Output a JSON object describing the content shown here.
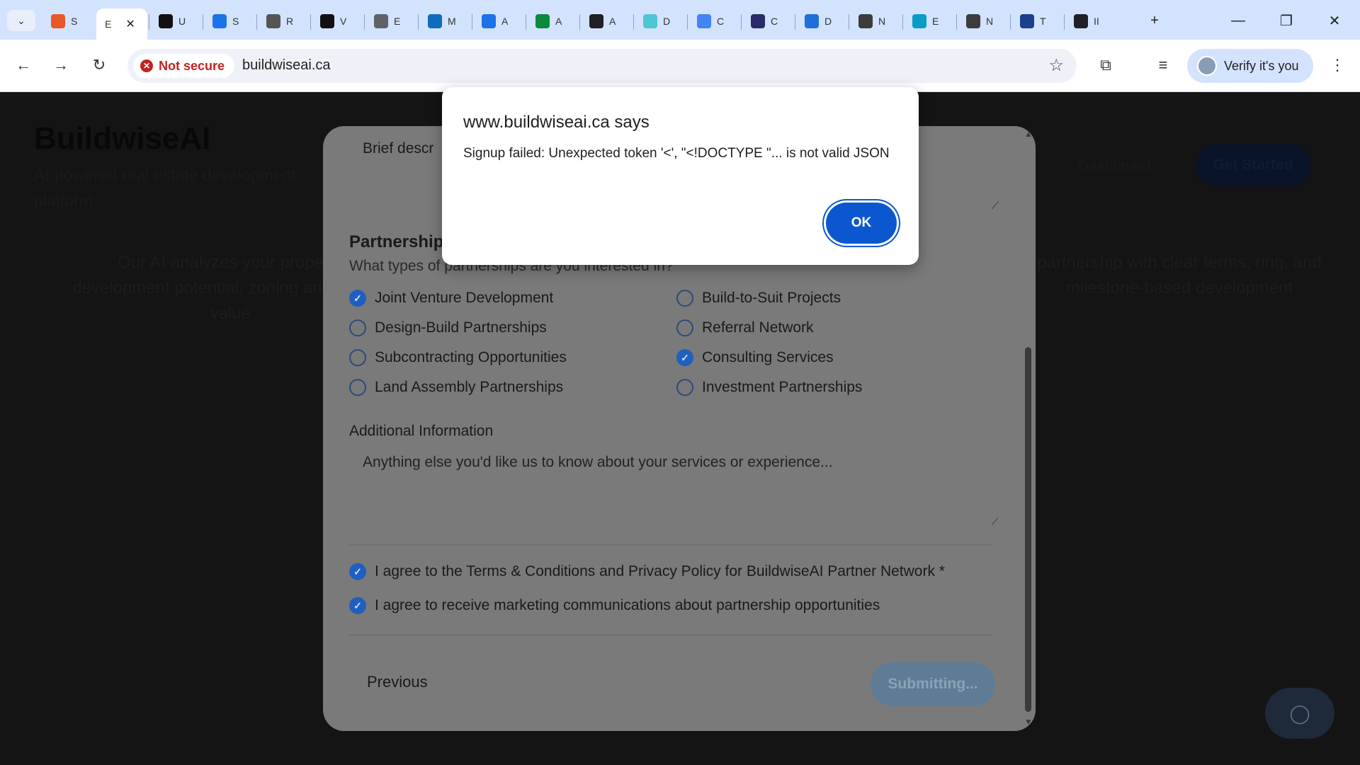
{
  "browser": {
    "tabs": [
      {
        "label": "S",
        "color": "#e8572a"
      },
      {
        "label": "E",
        "color": "#ffffff"
      },
      {
        "label": "U",
        "color": "#111111"
      },
      {
        "label": "S",
        "color": "#1a73e8"
      },
      {
        "label": "R",
        "color": "#555555"
      },
      {
        "label": "V",
        "color": "#111111"
      },
      {
        "label": "E",
        "color": "#5f6368"
      },
      {
        "label": "M",
        "color": "#0f6cbd"
      },
      {
        "label": "A",
        "color": "#1a73e8"
      },
      {
        "label": "A",
        "color": "#0a8a3a"
      },
      {
        "label": "A",
        "color": "#202124"
      },
      {
        "label": "D",
        "color": "#4ec6d4"
      },
      {
        "label": "C",
        "color": "#4285f4"
      },
      {
        "label": "C",
        "color": "#2b2b6b"
      },
      {
        "label": "D",
        "color": "#1e6fd9"
      },
      {
        "label": "N",
        "color": "#3c3c3c"
      },
      {
        "label": "E",
        "color": "#0a9cc7"
      },
      {
        "label": "N",
        "color": "#3c3c3c"
      },
      {
        "label": "T",
        "color": "#1b3f8b"
      },
      {
        "label": "II",
        "color": "#202124"
      }
    ],
    "new_tab": "+",
    "window_controls": {
      "minimize": "—",
      "restore": "❐",
      "close": "✕"
    },
    "security_label": "Not secure",
    "url": "buildwiseai.ca",
    "profile_label": "Verify it's you"
  },
  "page": {
    "brand": "BuildwiseAI",
    "tagline": "AI-powered real estate development platform",
    "nav_dashboard": "Dashboard",
    "nav_get_started": "Get Started",
    "feature_left": "Our AI analyzes your property development potential, zoning and market value",
    "feature_right": "partnership with clear terms, ring, and milestone-based development"
  },
  "modal": {
    "brief_placeholder": "Brief descr",
    "partnership_heading": "Partnership",
    "partnership_question": "What types of partnerships are you interested in?",
    "options": [
      {
        "label": "Joint Venture Development",
        "checked": true
      },
      {
        "label": "Build-to-Suit Projects",
        "checked": false
      },
      {
        "label": "Design-Build Partnerships",
        "checked": false
      },
      {
        "label": "Referral Network",
        "checked": false
      },
      {
        "label": "Subcontracting Opportunities",
        "checked": false
      },
      {
        "label": "Consulting Services",
        "checked": true
      },
      {
        "label": "Land Assembly Partnerships",
        "checked": false
      },
      {
        "label": "Investment Partnerships",
        "checked": false
      }
    ],
    "additional_label": "Additional Information",
    "additional_placeholder": "Anything else you'd like us to know about your services or experience...",
    "agree_terms": "I agree to the Terms & Conditions and Privacy Policy for BuildwiseAI Partner Network *",
    "agree_marketing": "I agree to receive marketing communications about partnership opportunities",
    "previous": "Previous",
    "submit": "Submitting..."
  },
  "dialog": {
    "title": "www.buildwiseai.ca says",
    "message": "Signup failed: Unexpected token '<', \"<!DOCTYPE \"... is not valid JSON",
    "ok": "OK"
  }
}
